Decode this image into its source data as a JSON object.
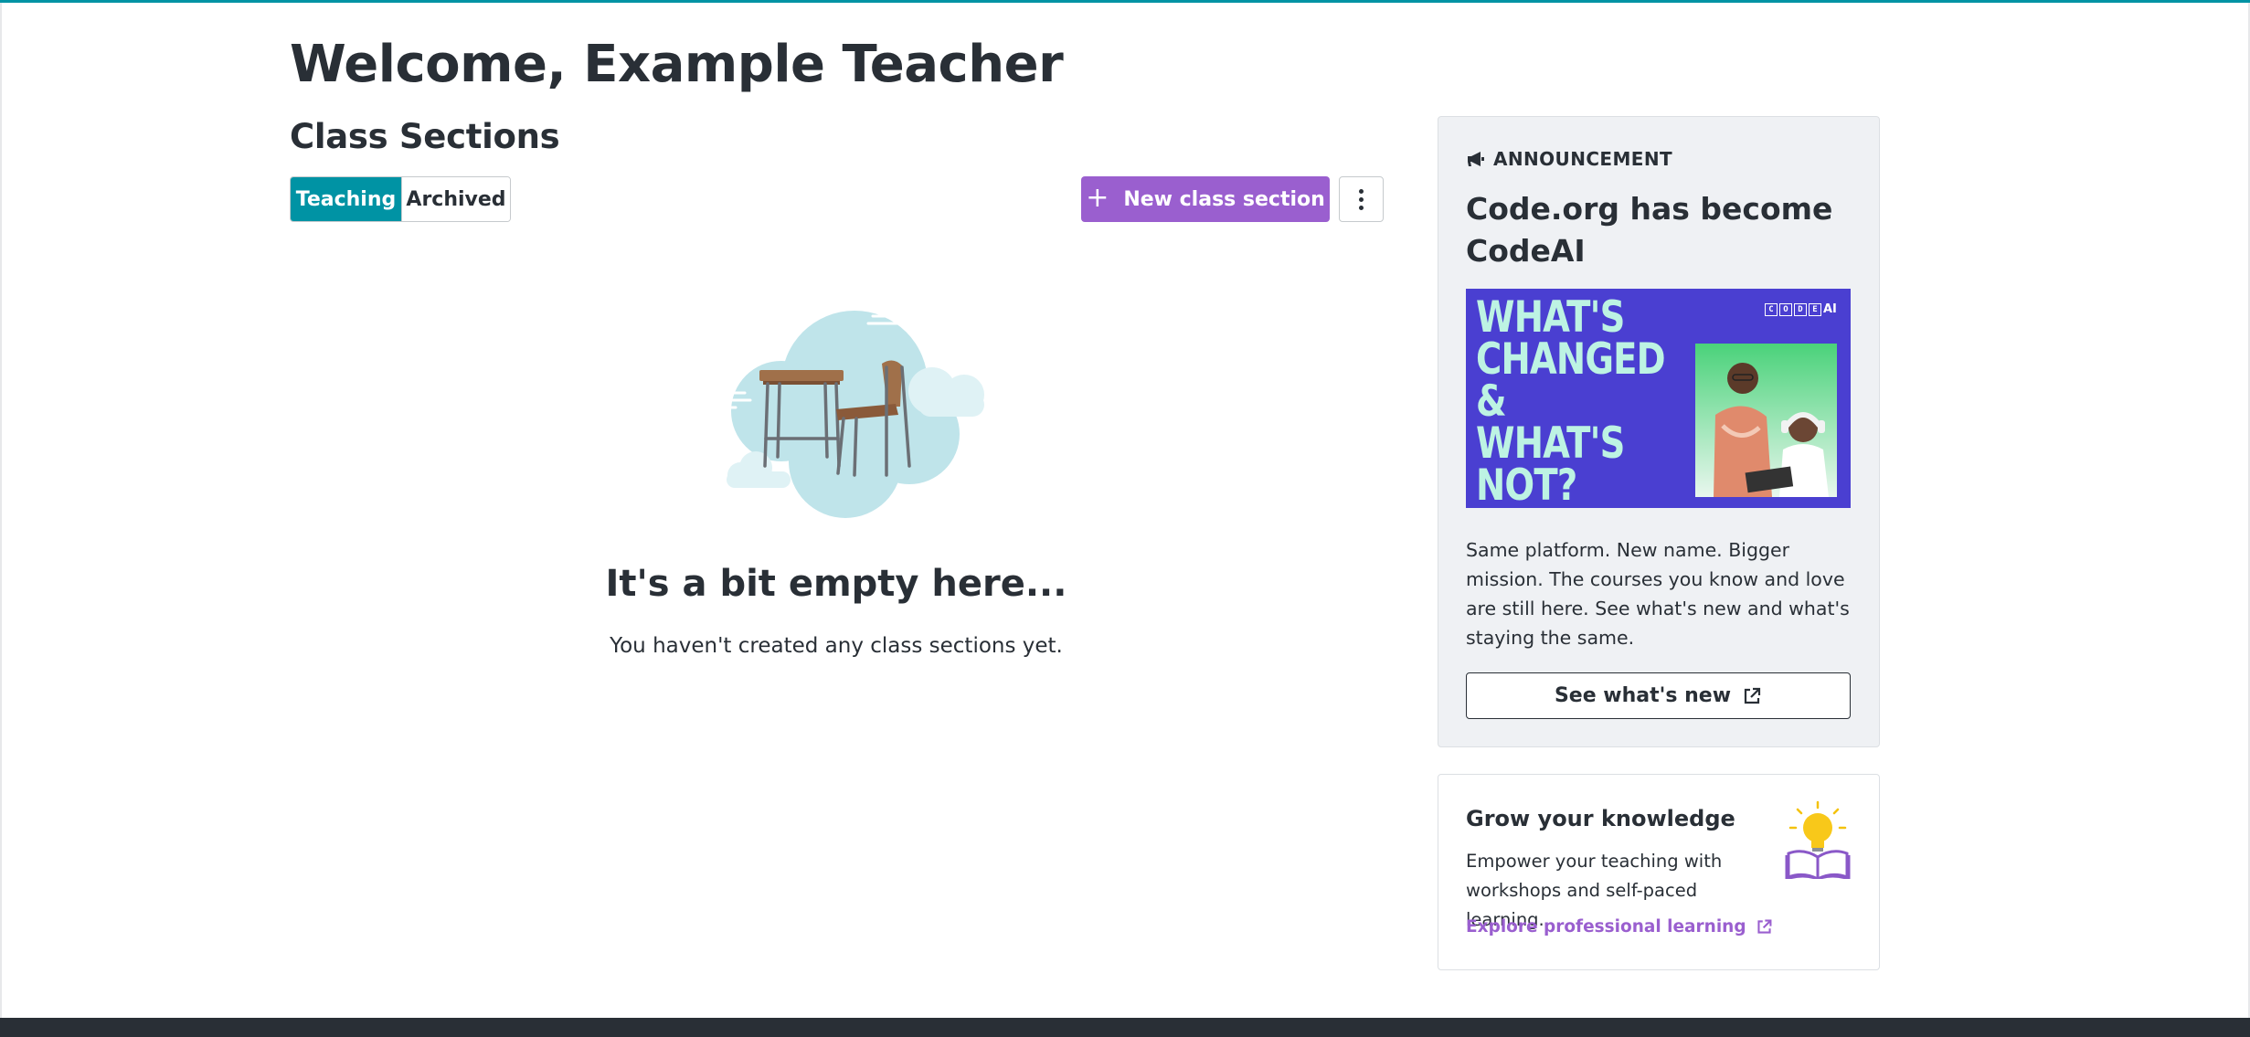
{
  "page": {
    "welcome": "Welcome, Example Teacher",
    "sections_title": "Class Sections"
  },
  "tabs": {
    "teaching": "Teaching",
    "archived": "Archived",
    "selected": "Teaching"
  },
  "actions": {
    "new_section_label": "New class section",
    "more_icon": "more-vertical-icon"
  },
  "empty_state": {
    "title": "It's a bit empty here...",
    "subtitle": "You haven't created any class sections yet."
  },
  "announcement": {
    "label": "ANNOUNCEMENT",
    "title": "Code.org has become CodeAI",
    "image_headline": "WHAT'S CHANGED & WHAT'S NOT?",
    "logo_text": "CODEAI",
    "body": "Same platform. New name. Bigger mission. The courses you know and love are still here. See what's new and what's staying the same.",
    "button_label": "See what's new"
  },
  "grow": {
    "title": "Grow your knowledge",
    "body": "Empower your teaching with workshops and self-paced learning.",
    "link_label": "Explore professional learning"
  },
  "colors": {
    "teal": "#0093a4",
    "purple": "#9a5fcf",
    "text": "#292f36",
    "banner_bg": "#4a3fd1",
    "banner_text": "#bdf3e3",
    "footer": "#292f36"
  }
}
